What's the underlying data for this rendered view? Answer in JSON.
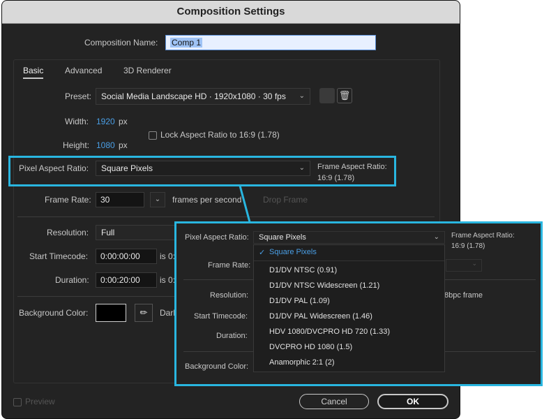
{
  "dialog": {
    "title": "Composition Settings"
  },
  "comp_name": {
    "label": "Composition Name:",
    "value": "Comp 1"
  },
  "tabs": [
    {
      "label": "Basic",
      "active": true
    },
    {
      "label": "Advanced",
      "active": false
    },
    {
      "label": "3D Renderer",
      "active": false
    }
  ],
  "preset": {
    "label": "Preset:",
    "value": "Social Media Landscape HD · 1920x1080 · 30 fps"
  },
  "width": {
    "label": "Width:",
    "value": "1920",
    "unit": "px"
  },
  "height": {
    "label": "Height:",
    "value": "1080",
    "unit": "px"
  },
  "lock_aspect": {
    "label": "Lock Aspect Ratio to 16:9 (1.78)",
    "checked": false
  },
  "pixel_aspect": {
    "label": "Pixel Aspect Ratio:",
    "value": "Square Pixels",
    "frame_aspect_label": "Frame Aspect Ratio:",
    "frame_aspect_value": "16:9 (1.78)"
  },
  "frame_rate": {
    "label": "Frame Rate:",
    "value": "30",
    "unit": "frames per second",
    "drop_frame": "Drop Frame"
  },
  "resolution": {
    "label": "Resolution:",
    "value": "Full"
  },
  "start_timecode": {
    "label": "Start Timecode:",
    "value": "0:00:00:00",
    "suffix": "is 0:"
  },
  "duration": {
    "label": "Duration:",
    "value": "0:00:20:00",
    "suffix": "is 0:"
  },
  "background": {
    "label": "Background Color:",
    "name": "Dark",
    "color": "#000000"
  },
  "footer": {
    "preview_label": "Preview",
    "cancel_label": "Cancel",
    "ok_label": "OK"
  },
  "colors": {
    "highlight": "#29b6e0",
    "accent": "#4a9fe6"
  },
  "popup": {
    "pixel_aspect_label": "Pixel Aspect Ratio:",
    "pixel_aspect_value": "Square Pixels",
    "frame_aspect_label": "Frame Aspect Ratio:",
    "frame_aspect_value": "16:9 (1.78)",
    "frame_rate_label": "Frame Rate:",
    "resolution_label": "Resolution:",
    "resolution_suffix": "8bpc frame",
    "start_timecode_label": "Start Timecode:",
    "duration_label": "Duration:",
    "background_label": "Background Color:",
    "menu_items": [
      "Square Pixels",
      "D1/DV NTSC (0.91)",
      "D1/DV NTSC Widescreen (1.21)",
      "D1/DV PAL (1.09)",
      "D1/DV PAL Widescreen (1.46)",
      "HDV 1080/DVCPRO HD 720 (1.33)",
      "DVCPRO HD 1080 (1.5)",
      "Anamorphic 2:1 (2)"
    ],
    "selected_item": "Square Pixels"
  }
}
